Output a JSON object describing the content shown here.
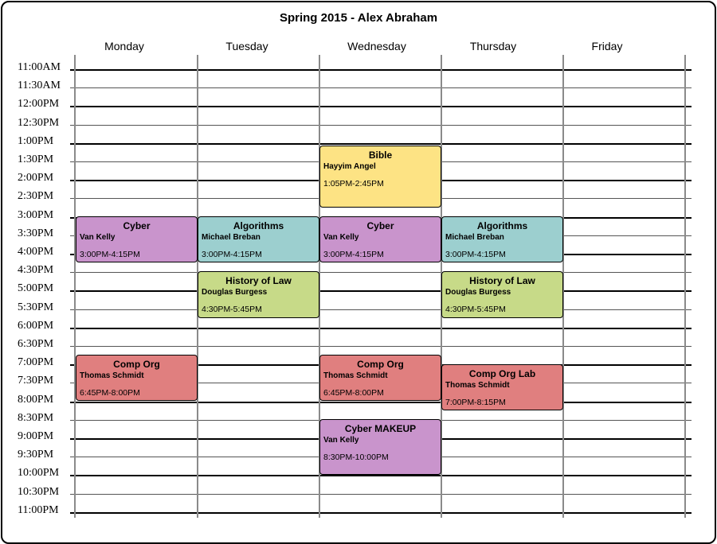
{
  "title": "Spring 2015 - Alex Abraham",
  "days": [
    "Monday",
    "Tuesday",
    "Wednesday",
    "Thursday",
    "Friday"
  ],
  "times": [
    "11:00AM",
    "11:30AM",
    "12:00PM",
    "12:30PM",
    "1:00PM",
    "1:30PM",
    "2:00PM",
    "2:30PM",
    "3:00PM",
    "3:30PM",
    "4:00PM",
    "4:30PM",
    "5:00PM",
    "5:30PM",
    "6:00PM",
    "6:30PM",
    "7:00PM",
    "7:30PM",
    "8:00PM",
    "8:30PM",
    "9:00PM",
    "9:30PM",
    "10:00PM",
    "10:30PM",
    "11:00PM"
  ],
  "colors": {
    "cyber": "#c994cc",
    "algorithms": "#9ccfcf",
    "history": "#c7da88",
    "comporg": "#e07f7f",
    "bible": "#fde384"
  },
  "events": [
    {
      "title": "Bible",
      "instructor": "Hayyim Angel",
      "time": "1:05PM-2:45PM"
    },
    {
      "title": "Cyber",
      "instructor": "Van Kelly",
      "time": "3:00PM-4:15PM"
    },
    {
      "title": "Algorithms",
      "instructor": "Michael Breban",
      "time": "3:00PM-4:15PM"
    },
    {
      "title": "Cyber",
      "instructor": "Van Kelly",
      "time": "3:00PM-4:15PM"
    },
    {
      "title": "Algorithms",
      "instructor": "Michael Breban",
      "time": "3:00PM-4:15PM"
    },
    {
      "title": "History of Law",
      "instructor": "Douglas Burgess",
      "time": "4:30PM-5:45PM"
    },
    {
      "title": "History of Law",
      "instructor": "Douglas Burgess",
      "time": "4:30PM-5:45PM"
    },
    {
      "title": "Comp Org",
      "instructor": "Thomas Schmidt",
      "time": "6:45PM-8:00PM"
    },
    {
      "title": "Comp Org",
      "instructor": "Thomas Schmidt",
      "time": "6:45PM-8:00PM"
    },
    {
      "title": "Comp Org Lab",
      "instructor": "Thomas Schmidt",
      "time": "7:00PM-8:15PM"
    },
    {
      "title": "Cyber MAKEUP",
      "instructor": "Van Kelly",
      "time": "8:30PM-10:00PM"
    }
  ]
}
